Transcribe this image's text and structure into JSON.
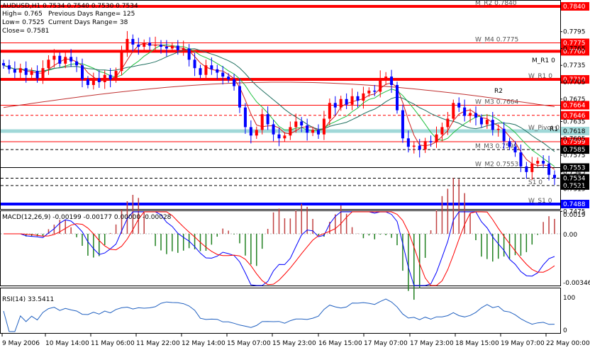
{
  "header": {
    "title": "AUDUSD,H1  0.7534 0.7540 0.7530 0.7534",
    "high": "High= 0.765",
    "low": "Low= 0.7525",
    "close": "Close= 0.7581",
    "prev_range": "Previous Days Range= 125",
    "curr_range": "Current Days Range= 38"
  },
  "levels": [
    {
      "price": 0.784,
      "label": "0.7840",
      "color": "#ff0000",
      "kind": "thick",
      "text": "M_R2 0.7840"
    },
    {
      "price": 0.7775,
      "label": "0.7775",
      "color": "#ff0000",
      "kind": "thin",
      "text": "W_M4 0.7775"
    },
    {
      "price": 0.776,
      "label": "0.7760",
      "color": "#ff0000",
      "kind": "thick",
      "text": ""
    },
    {
      "price": 0.771,
      "label": "0.7710",
      "color": "#ff0000",
      "kind": "thick",
      "text": "W_R1 0"
    },
    {
      "price": 0.7664,
      "label": "0.7664",
      "color": "#ff0000",
      "kind": "thin",
      "text": "W_M3 0.7664"
    },
    {
      "price": 0.7646,
      "label": "0.7646",
      "color": "#ff0000",
      "kind": "dash",
      "text": ""
    },
    {
      "price": 0.7618,
      "label": "0.7618",
      "color": "#a0d8d8",
      "kind": "pivot",
      "text": "W_Pivot 0"
    },
    {
      "price": 0.7599,
      "label": "0.7599",
      "color": "#ff0000",
      "kind": "thin",
      "text": ""
    },
    {
      "price": 0.7585,
      "label": "0.7585",
      "color": "#000000",
      "kind": "dash",
      "text": "M_M3 0.7599"
    },
    {
      "price": 0.7553,
      "label": "0.7553",
      "color": "#000000",
      "kind": "thin",
      "text": "W_M2 0.7553"
    },
    {
      "price": 0.7534,
      "label": "0.7534",
      "color": "#000000",
      "kind": "dash",
      "text": ""
    },
    {
      "price": 0.7521,
      "label": "0.7521",
      "color": "#000000",
      "kind": "dash",
      "text": "S1 0"
    },
    {
      "price": 0.7488,
      "label": "0.7488",
      "color": "#0000ff",
      "kind": "thick",
      "text": "W_S1 0"
    }
  ],
  "side_labels": {
    "m_r1": "M_R1 0",
    "r2": "R2",
    "r1": "R1",
    "pivot_d": "Pivot 0"
  },
  "price_axis": [
    "0.7795",
    "0.7765",
    "0.7735",
    "0.7705",
    "0.7675",
    "0.7635",
    "0.7605",
    "0.7575",
    "0.7545",
    "0.7515",
    "0.7475"
  ],
  "macd": {
    "label": "MACD(12,26,9) -0.00199 -0.00177 0.00000 -0.00028",
    "top": "0.0019",
    "zero": "0.00",
    "bottom": "-0.00346"
  },
  "rsi": {
    "label": "RSI(14) 33.5411",
    "top": "100",
    "bottom": "0"
  },
  "time_axis": [
    "9 May 2006",
    "10 May 14:00",
    "11 May 06:00",
    "11 May 22:00",
    "12 May 14:00",
    "15 May 07:00",
    "15 May 23:00",
    "16 May 15:00",
    "17 May 07:00",
    "17 May 23:00",
    "18 May 15:00",
    "19 May 07:00",
    "22 May 00:00"
  ],
  "chart_data": {
    "type": "candlestick",
    "instrument": "AUDUSD,H1",
    "ylim": [
      0.747,
      0.7845
    ],
    "closes": [
      0.7735,
      0.7728,
      0.7722,
      0.773,
      0.7718,
      0.7725,
      0.7712,
      0.773,
      0.7745,
      0.7752,
      0.7738,
      0.775,
      0.7742,
      0.7735,
      0.771,
      0.77,
      0.7712,
      0.7705,
      0.7718,
      0.771,
      0.7725,
      0.776,
      0.7782,
      0.7772,
      0.7768,
      0.7775,
      0.777,
      0.7772,
      0.7768,
      0.7765,
      0.777,
      0.7762,
      0.7765,
      0.7745,
      0.773,
      0.7718,
      0.7735,
      0.7728,
      0.7722,
      0.7715,
      0.771,
      0.7698,
      0.766,
      0.7625,
      0.761,
      0.762,
      0.7648,
      0.763,
      0.7612,
      0.7605,
      0.761,
      0.7625,
      0.7635,
      0.7628,
      0.7615,
      0.762,
      0.7612,
      0.764,
      0.7668,
      0.766,
      0.7675,
      0.7665,
      0.768,
      0.7672,
      0.7685,
      0.769,
      0.7688,
      0.7712,
      0.7715,
      0.77,
      0.7655,
      0.7605,
      0.759,
      0.7592,
      0.7585,
      0.76,
      0.7598,
      0.7612,
      0.7625,
      0.764,
      0.7668,
      0.766,
      0.7645,
      0.765,
      0.7642,
      0.763,
      0.7638,
      0.762,
      0.7622,
      0.76,
      0.759,
      0.758,
      0.7555,
      0.7545,
      0.756,
      0.7565,
      0.756,
      0.754,
      0.7534
    ]
  }
}
